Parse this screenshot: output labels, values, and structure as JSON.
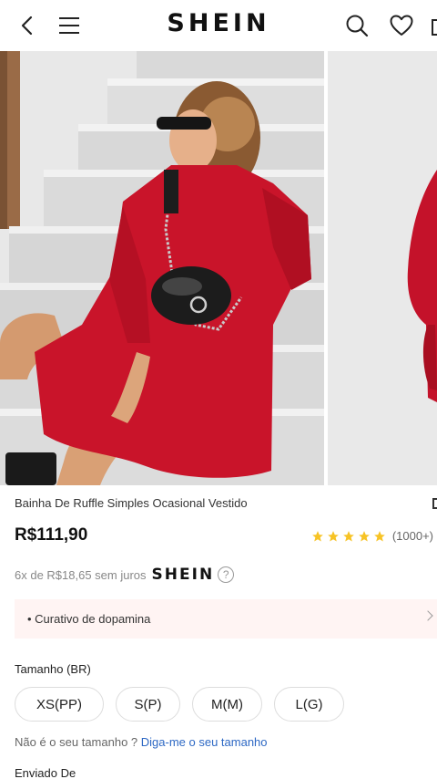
{
  "header": {
    "logo": "SHEIN",
    "icons": [
      "back-arrow-icon",
      "menu-icon",
      "search-icon",
      "heart-icon",
      "bag-icon"
    ]
  },
  "gallery": {
    "images": [
      "product-photo-main",
      "product-photo-next"
    ]
  },
  "product": {
    "title": "Bainha De Ruffle Simples Ocasional Vestido",
    "price": "R$111,90",
    "rating": 5,
    "review_count": "(1000+)",
    "installment_text": "6x de R$18,65 sem juros",
    "installment_logo": "SHEIN",
    "info_glyph": "?"
  },
  "promo": {
    "label": "• Curativo de dopamina"
  },
  "size": {
    "label": "Tamanho (BR)",
    "options": [
      "XS(PP)",
      "S(P)",
      "M(M)",
      "L(G)"
    ],
    "help_text": "Não é o seu tamanho ? ",
    "help_link": "Diga-me o seu tamanho"
  },
  "shipping": {
    "label": "Enviado De"
  },
  "colors": {
    "star": "#f7c325",
    "link": "#2d68c4",
    "dress": "#c9142a",
    "promo_bg": "#fff4f3"
  }
}
